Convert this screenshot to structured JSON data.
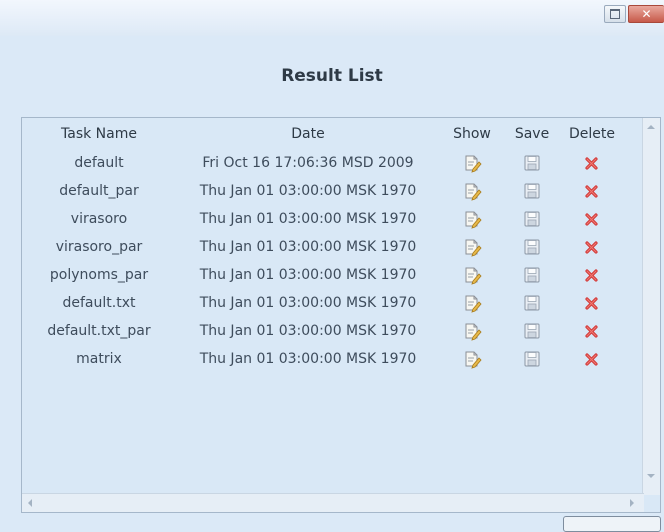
{
  "window": {
    "close_glyph": "✕",
    "restore_icon": "restore-icon",
    "close_icon": "close-icon"
  },
  "page_title": "Result List",
  "table": {
    "columns": {
      "name": "Task Name",
      "date": "Date",
      "show": "Show",
      "save": "Save",
      "delete": "Delete"
    },
    "rows": [
      {
        "name": "default",
        "date": "Fri Oct 16 17:06:36 MSD 2009"
      },
      {
        "name": "default_par",
        "date": "Thu Jan 01 03:00:00 MSK 1970"
      },
      {
        "name": "virasoro",
        "date": "Thu Jan 01 03:00:00 MSK 1970"
      },
      {
        "name": "virasoro_par",
        "date": "Thu Jan 01 03:00:00 MSK 1970"
      },
      {
        "name": "polynoms_par",
        "date": "Thu Jan 01 03:00:00 MSK 1970"
      },
      {
        "name": "default.txt",
        "date": "Thu Jan 01 03:00:00 MSK 1970"
      },
      {
        "name": "default.txt_par",
        "date": "Thu Jan 01 03:00:00 MSK 1970"
      },
      {
        "name": "matrix",
        "date": "Thu Jan 01 03:00:00 MSK 1970"
      }
    ],
    "row_icons": {
      "show": "show-document-icon",
      "save": "save-disk-icon",
      "delete": "delete-x-icon"
    }
  },
  "colors": {
    "background": "#dbe9f7",
    "delete_icon": "#d23b3b",
    "text": "#3e4c5c"
  }
}
